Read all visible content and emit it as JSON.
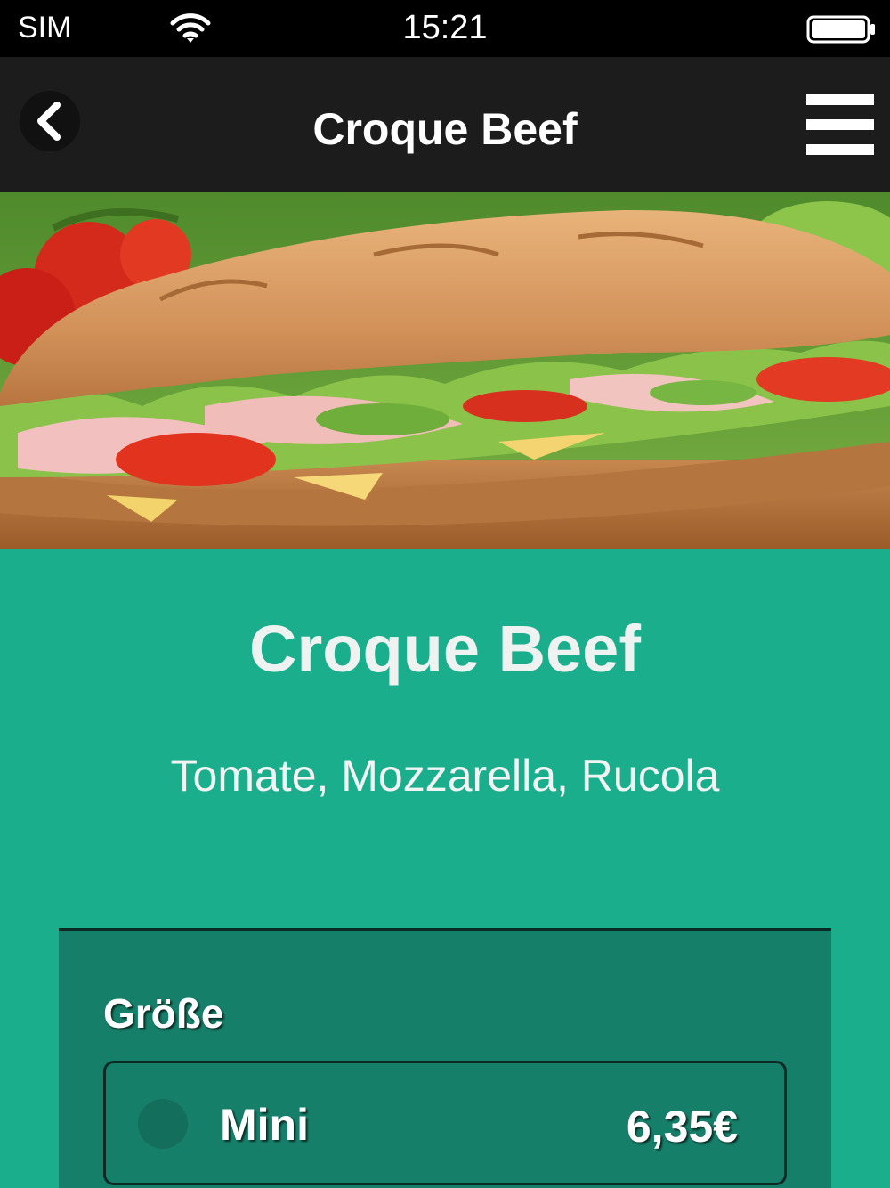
{
  "status_bar": {
    "carrier": "SIM",
    "time": "15:21",
    "wifi_icon": "wifi-icon",
    "battery_icon": "battery-full-icon"
  },
  "nav": {
    "title": "Croque Beef",
    "back_icon": "chevron-left-icon",
    "menu_icon": "hamburger-menu-icon"
  },
  "hero": {
    "image": "sandwich-photo"
  },
  "product": {
    "title": "Croque Beef",
    "description": "Tomate, Mozzarella, Rucola"
  },
  "options": {
    "label": "Größe",
    "items": [
      {
        "name": "Mini",
        "price": "6,35€",
        "selected": false
      }
    ]
  },
  "colors": {
    "background": "#1aae8c",
    "panel": "#167f6a",
    "nav_bar": "#1c1c1c",
    "status_bar": "#000000"
  }
}
